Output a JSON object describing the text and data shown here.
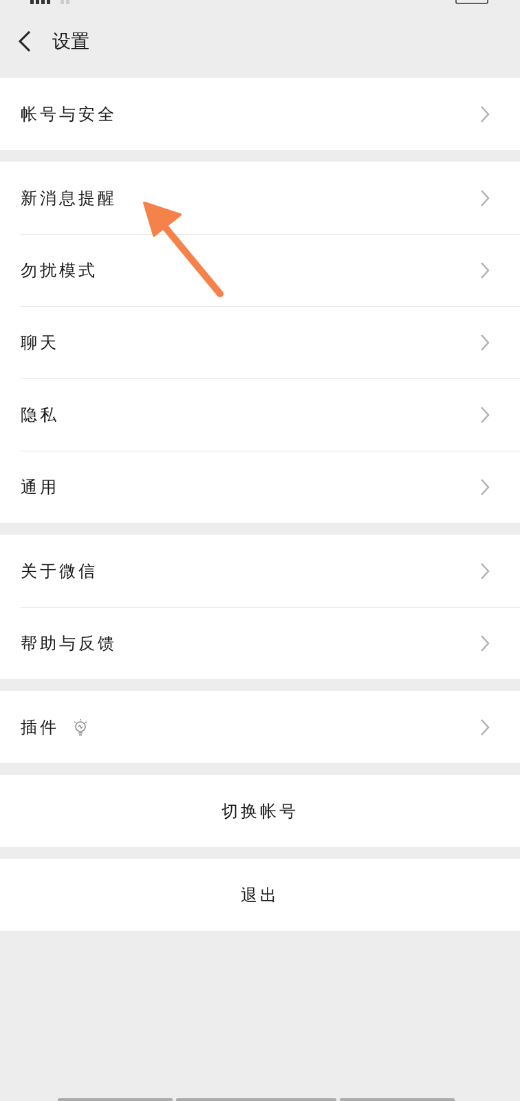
{
  "header": {
    "title": "设置"
  },
  "sections": [
    {
      "kind": "list",
      "items": [
        {
          "label": "帐号与安全",
          "kind": "plain"
        }
      ]
    },
    {
      "kind": "list",
      "items": [
        {
          "label": "新消息提醒",
          "kind": "plain"
        },
        {
          "label": "勿扰模式",
          "kind": "plain"
        },
        {
          "label": "聊天",
          "kind": "plain"
        },
        {
          "label": "隐私",
          "kind": "plain"
        },
        {
          "label": "通用",
          "kind": "plain"
        }
      ]
    },
    {
      "kind": "list",
      "items": [
        {
          "label": "关于微信",
          "kind": "plain"
        },
        {
          "label": "帮助与反馈",
          "kind": "plain"
        }
      ]
    },
    {
      "kind": "list",
      "items": [
        {
          "label": "插件",
          "kind": "plugin"
        }
      ]
    },
    {
      "kind": "button",
      "label": "切换帐号"
    },
    {
      "kind": "button",
      "label": "退出"
    }
  ],
  "annotation": {
    "kind": "arrow"
  }
}
